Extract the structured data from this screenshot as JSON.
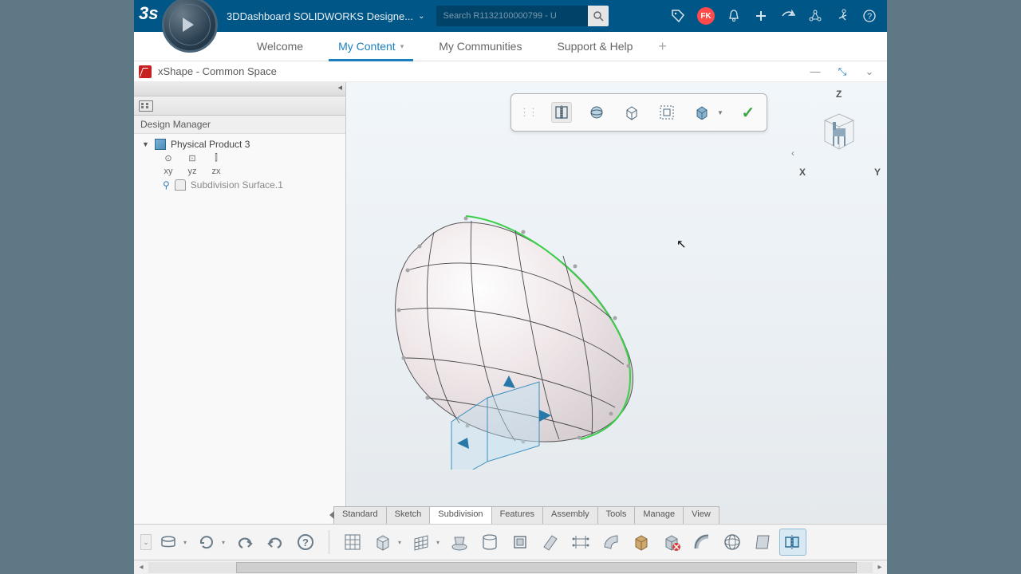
{
  "topbar": {
    "app_title": "3DDashboard  SOLIDWORKS Designe...",
    "search_placeholder": "Search R1132100000799 - U",
    "badge": "FK"
  },
  "nav": {
    "tabs": [
      "Welcome",
      "My Content",
      "My Communities",
      "Support & Help"
    ],
    "active_index": 1
  },
  "doc": {
    "title": "xShape - Common Space"
  },
  "design_manager": {
    "label": "Design Manager",
    "root": "Physical Product 3",
    "planes_row1": [
      "⊙",
      "⊡",
      "⫿"
    ],
    "planes_row2": [
      "xy",
      "yz",
      "zx"
    ],
    "child": "Subdivision Surface.1"
  },
  "gizmo": {
    "z": "Z",
    "x": "X",
    "y": "Y"
  },
  "bottom_tabs": {
    "items": [
      "Standard",
      "Sketch",
      "Subdivision",
      "Features",
      "Assembly",
      "Tools",
      "Manage",
      "View"
    ],
    "active_index": 2
  }
}
